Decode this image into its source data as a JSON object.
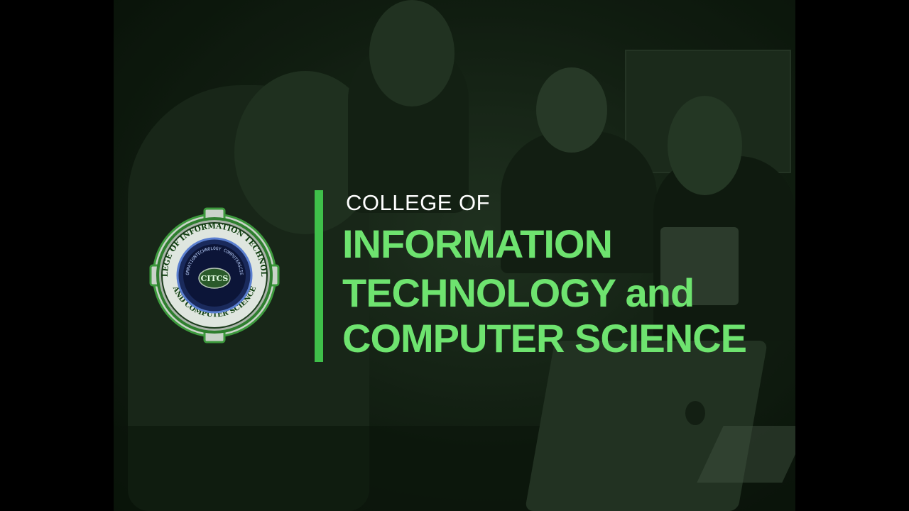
{
  "title": {
    "small": "COLLEGE OF",
    "line1": "INFORMATION",
    "line2": "TECHNOLOGY and",
    "line3": "COMPUTER SCIENCE"
  },
  "logo": {
    "ring_text_top": "COLLEGE OF INFORMATION TECHNOLOGY",
    "ring_text_bottom": "AND COMPUTER SCIENCE",
    "inner_text": "INFORMATIONTECHNOLOGY COMPUTERSCIENCE",
    "abbreviation": "CITCS"
  },
  "colors": {
    "accent": "#3fbf4a",
    "title_green": "#6ee36f",
    "title_white": "#ffffff"
  }
}
